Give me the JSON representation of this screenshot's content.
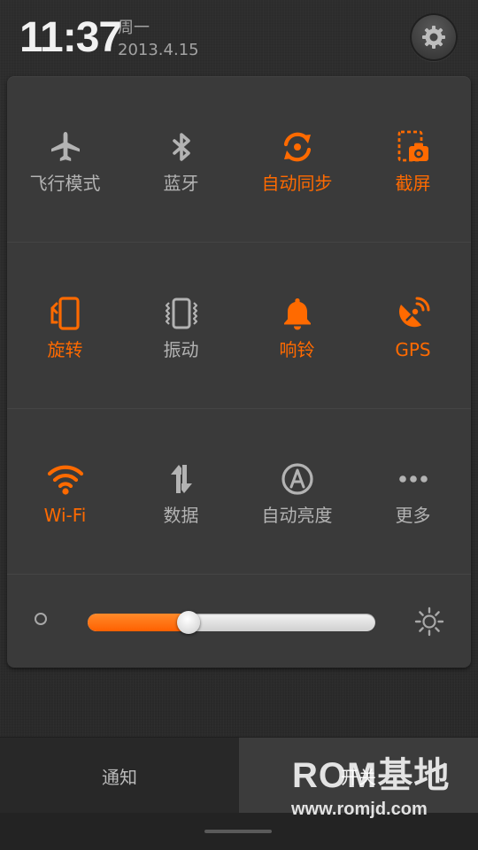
{
  "status": {
    "time": "11:37",
    "weekday": "周一",
    "date": "2013.4.15"
  },
  "header": {
    "settings_icon": "gear-icon"
  },
  "colors": {
    "accent": "#ff6a00",
    "inactive": "#b3b3b3",
    "panel": "#3a3a3a"
  },
  "toggles": [
    {
      "id": "airplane",
      "label": "飞行模式",
      "icon": "airplane-icon",
      "on": false
    },
    {
      "id": "bluetooth",
      "label": "蓝牙",
      "icon": "bluetooth-icon",
      "on": false
    },
    {
      "id": "autosync",
      "label": "自动同步",
      "icon": "sync-icon",
      "on": true
    },
    {
      "id": "screenshot",
      "label": "截屏",
      "icon": "screenshot-icon",
      "on": true
    },
    {
      "id": "rotate",
      "label": "旋转",
      "icon": "rotate-icon",
      "on": true
    },
    {
      "id": "vibrate",
      "label": "振动",
      "icon": "vibrate-icon",
      "on": false
    },
    {
      "id": "ring",
      "label": "响铃",
      "icon": "bell-icon",
      "on": true
    },
    {
      "id": "gps",
      "label": "GPS",
      "icon": "gps-icon",
      "on": true
    },
    {
      "id": "wifi",
      "label": "Wi-Fi",
      "icon": "wifi-icon",
      "on": true
    },
    {
      "id": "data",
      "label": "数据",
      "icon": "data-icon",
      "on": false
    },
    {
      "id": "autobrightness",
      "label": "自动亮度",
      "icon": "auto-brightness-icon",
      "on": false
    },
    {
      "id": "more",
      "label": "更多",
      "icon": "more-icon",
      "on": false
    }
  ],
  "brightness": {
    "level": 0.35,
    "low_icon": "brightness-low-icon",
    "high_icon": "brightness-high-icon"
  },
  "tabs": [
    {
      "label": "通知",
      "selected": false
    },
    {
      "label": "开关",
      "selected": true
    }
  ],
  "watermark": {
    "title": "ROM基地",
    "url": "www.romjd.com"
  }
}
